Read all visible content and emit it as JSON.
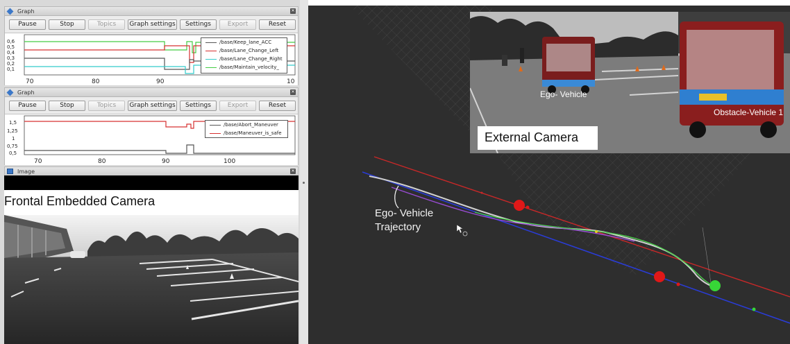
{
  "graph1": {
    "title": "Graph",
    "buttons": [
      "Pause",
      "Stop",
      "Topics",
      "Graph settings",
      "Settings",
      "Export",
      "Reset"
    ],
    "y_ticks": [
      "0,6",
      "0,5",
      "0,4",
      "0,3",
      "0,2",
      "0,1"
    ],
    "x_ticks": [
      "70",
      "80",
      "90",
      "10"
    ],
    "legend": [
      {
        "label": "/base/Keep_lane_ACC",
        "color": "#555555"
      },
      {
        "label": "/base/Lane_Change_Left",
        "color": "#d63030"
      },
      {
        "label": "/base/Lane_Change_Right",
        "color": "#33cccc"
      },
      {
        "label": "/base/Maintain_velocity_",
        "color": "#44cc44"
      }
    ]
  },
  "graph2": {
    "title": "Graph",
    "buttons": [
      "Pause",
      "Stop",
      "Topics",
      "Graph settings",
      "Settings",
      "Export",
      "Reset"
    ],
    "y_ticks": [
      "1,5",
      "1,25",
      "1",
      "0,75",
      "0,5"
    ],
    "x_ticks": [
      "70",
      "80",
      "90",
      "100"
    ],
    "legend": [
      {
        "label": "/base/Abort_Maneuver",
        "color": "#555555"
      },
      {
        "label": "/base/Maneuver_is_safe",
        "color": "#d63030"
      }
    ]
  },
  "image_panel": {
    "title": "Image",
    "camera_label": "Frontal Embedded Camera"
  },
  "external_camera": {
    "label": "External Camera",
    "ego_label": "Ego- Vehicle",
    "obstacle_label": "Obstacle-Vehicle 1"
  },
  "rviz": {
    "trajectory_label_line1": "Ego- Vehicle",
    "trajectory_label_line2": "Trajectory"
  }
}
